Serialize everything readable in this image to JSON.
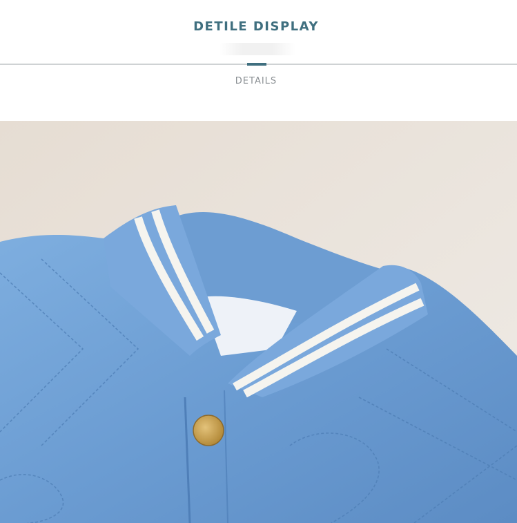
{
  "header": {
    "title": "DETILE DISPLAY",
    "subtitle": "DETAILS"
  },
  "colors": {
    "title": "#3f6f7f",
    "subtitle": "#8a8f93",
    "divider": "#cfd2d4",
    "jacket_blue": "#6f9fd4",
    "background_beige": "#ebe5de",
    "button_gold": "#c8a24e"
  },
  "photo": {
    "subject": "jacket-collar-closeup"
  }
}
